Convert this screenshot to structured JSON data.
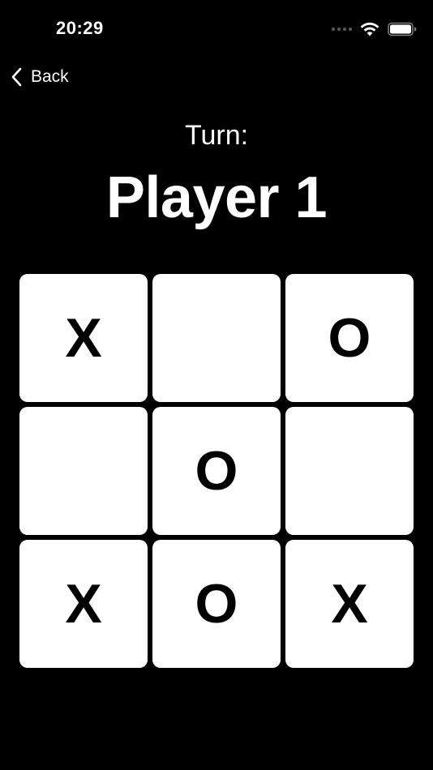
{
  "status_bar": {
    "time": "20:29",
    "icons": [
      "signal-dots-icon",
      "wifi-icon",
      "battery-icon"
    ]
  },
  "nav": {
    "back_label": "Back",
    "back_icon": "chevron-left-icon"
  },
  "game": {
    "turn_label": "Turn:",
    "current_player": "Player 1",
    "board": [
      [
        "X",
        "",
        "O"
      ],
      [
        "",
        "O",
        ""
      ],
      [
        "X",
        "O",
        "X"
      ]
    ]
  },
  "colors": {
    "background": "#000000",
    "text": "#ffffff",
    "cell_background": "#ffffff",
    "mark": "#000000"
  }
}
